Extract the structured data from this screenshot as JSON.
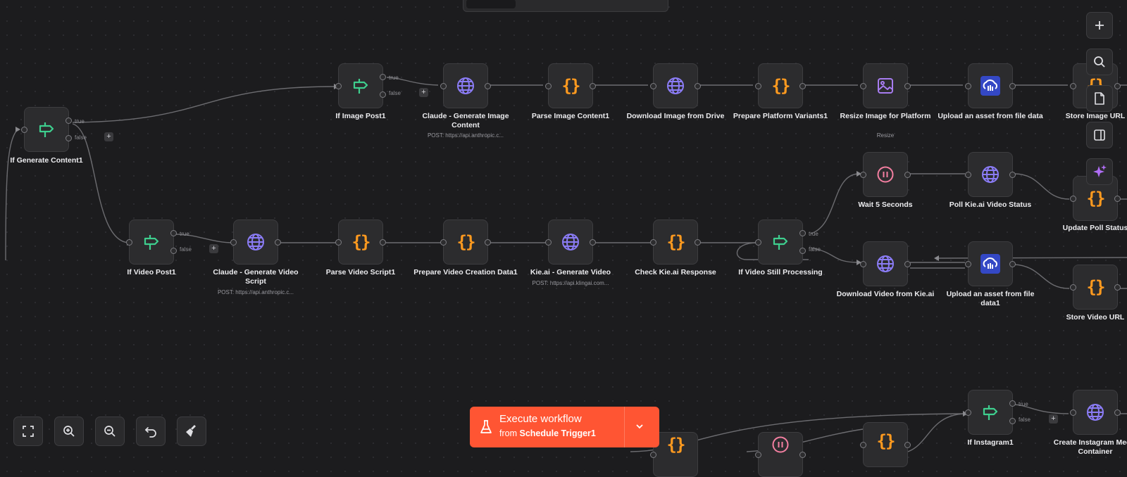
{
  "canvas": {
    "nodes": [
      {
        "id": "if_gen",
        "label": "If Generate Content1",
        "icon": "signpost-icon"
      },
      {
        "id": "if_img",
        "label": "If Image Post1",
        "icon": "signpost-icon"
      },
      {
        "id": "claude_img",
        "label": "Claude - Generate Image Content",
        "sub": "POST: https://api.anthropic.c...",
        "icon": "globe-icon"
      },
      {
        "id": "parse_img",
        "label": "Parse Image Content1",
        "icon": "code-braces-icon"
      },
      {
        "id": "dl_img",
        "label": "Download Image from Drive",
        "icon": "globe-icon"
      },
      {
        "id": "prep_plat",
        "label": "Prepare Platform Variants1",
        "icon": "code-braces-icon"
      },
      {
        "id": "resize",
        "label": "Resize Image for Platform",
        "sub": "Resize",
        "icon": "image-icon"
      },
      {
        "id": "upload1",
        "label": "Upload an asset from file data",
        "icon": "cloudinary-icon"
      },
      {
        "id": "store_img",
        "label": "Store Image URL",
        "icon": "code-braces-icon"
      },
      {
        "id": "wait5",
        "label": "Wait 5 Seconds",
        "icon": "pause-icon"
      },
      {
        "id": "poll",
        "label": "Poll Kie.ai Video Status",
        "icon": "globe-icon"
      },
      {
        "id": "upd_poll",
        "label": "Update Poll Status",
        "icon": "code-braces-icon"
      },
      {
        "id": "if_vid",
        "label": "If Video Post1",
        "icon": "signpost-icon"
      },
      {
        "id": "claude_vid",
        "label": "Claude - Generate Video Script",
        "sub": "POST: https://api.anthropic.c...",
        "icon": "globe-icon"
      },
      {
        "id": "parse_vid",
        "label": "Parse Video Script1",
        "icon": "code-braces-icon"
      },
      {
        "id": "prep_vid",
        "label": "Prepare Video Creation Data1",
        "icon": "code-braces-icon"
      },
      {
        "id": "kie_gen",
        "label": "Kie.ai - Generate Video",
        "sub": "POST: https://api.klingai.com...",
        "icon": "globe-icon"
      },
      {
        "id": "check_kie",
        "label": "Check Kie.ai Response",
        "icon": "code-braces-icon"
      },
      {
        "id": "if_still",
        "label": "If Video Still Processing",
        "icon": "signpost-icon"
      },
      {
        "id": "dl_vid",
        "label": "Download Video from Kie.ai",
        "icon": "globe-icon"
      },
      {
        "id": "upload2",
        "label": "Upload an asset from file data1",
        "icon": "cloudinary-icon"
      },
      {
        "id": "store_vid",
        "label": "Store Video URL",
        "icon": "code-braces-icon"
      },
      {
        "id": "b_code1",
        "label": "",
        "icon": "code-braces-icon"
      },
      {
        "id": "b_wait",
        "label": "",
        "icon": "pause-icon"
      },
      {
        "id": "b_code2",
        "label": "",
        "icon": "code-braces-icon"
      },
      {
        "id": "if_insta",
        "label": "If Instagram1",
        "icon": "signpost-icon"
      },
      {
        "id": "insta_media",
        "label": "Create Instagram Media Container",
        "icon": "globe-icon"
      }
    ],
    "branch_true": "true",
    "branch_false": "false",
    "add_symbol": "+"
  },
  "right_toolbar": [
    {
      "name": "add-node-button",
      "icon": "plus-icon"
    },
    {
      "name": "search-nodes-button",
      "icon": "search-icon"
    },
    {
      "name": "sticky-note-button",
      "icon": "note-icon"
    },
    {
      "name": "toggle-panel-button",
      "icon": "panel-icon"
    },
    {
      "name": "ai-assistant-button",
      "icon": "sparkle-icon"
    }
  ],
  "bottom_toolbar": [
    {
      "name": "fit-view-button",
      "icon": "fullscreen-icon"
    },
    {
      "name": "zoom-in-button",
      "icon": "zoom-in-icon"
    },
    {
      "name": "zoom-out-button",
      "icon": "zoom-out-icon"
    },
    {
      "name": "undo-button",
      "icon": "undo-icon"
    },
    {
      "name": "tidy-up-button",
      "icon": "broom-icon"
    }
  ],
  "execute": {
    "title": "Execute workflow",
    "from_prefix": "from",
    "trigger": "Schedule Trigger1"
  },
  "colors": {
    "background": "#1c1c1e",
    "node_bg": "#2c2c2e",
    "if_green": "#3ecf8e",
    "globe_purple": "#8b7cf6",
    "code_orange": "#ff9a1f",
    "wait_pink": "#f47fa1",
    "execute_red": "#ff5533"
  }
}
